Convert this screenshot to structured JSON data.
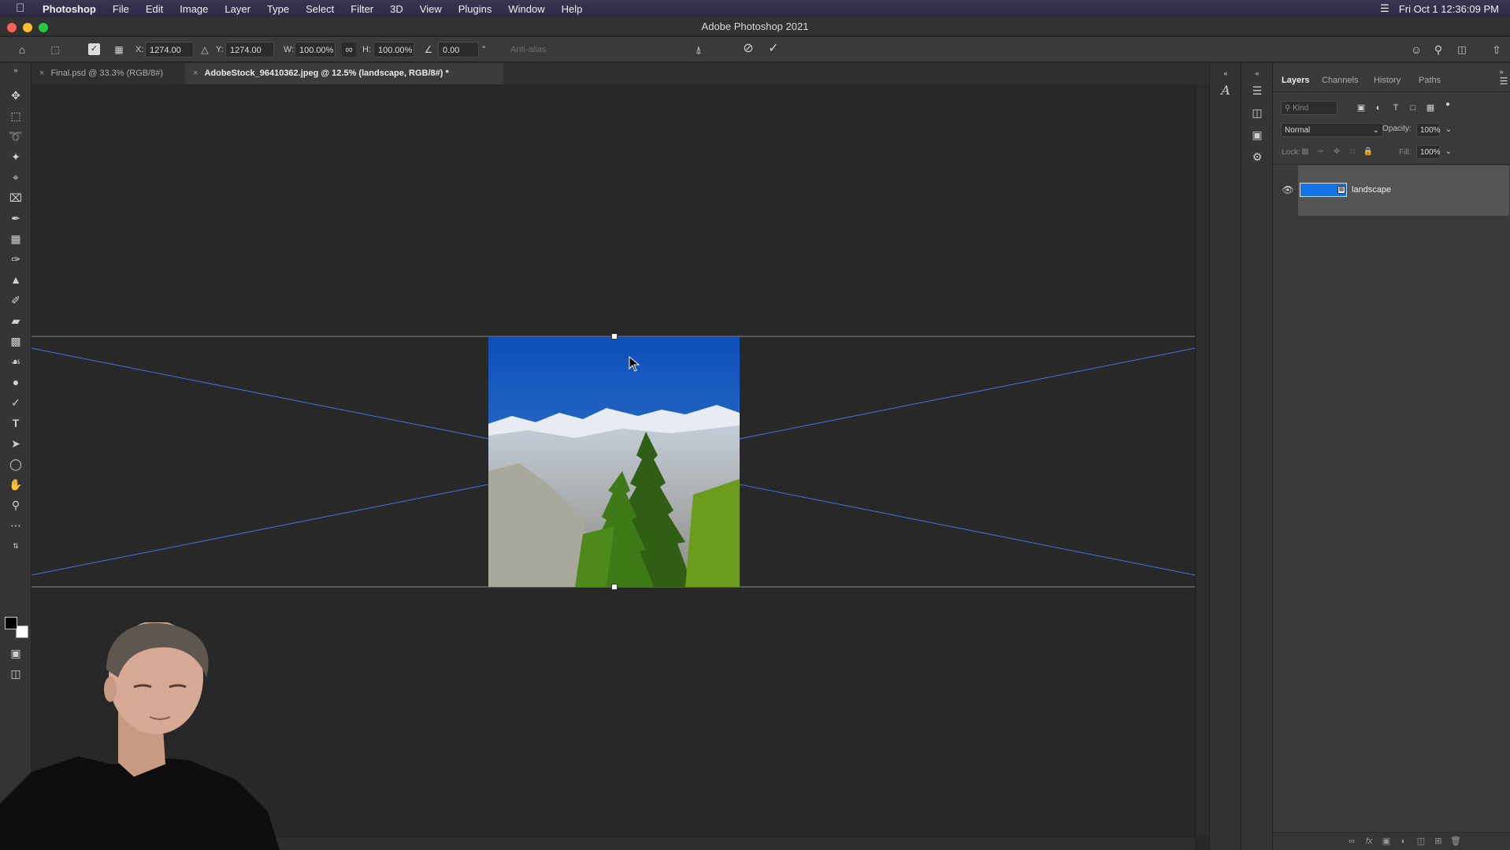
{
  "menubar": {
    "app": "Photoshop",
    "items": [
      "File",
      "Edit",
      "Image",
      "Layer",
      "Type",
      "Select",
      "Filter",
      "3D",
      "View",
      "Plugins",
      "Window",
      "Help"
    ],
    "clock": "Fri Oct 1  12:36:09 PM"
  },
  "window": {
    "title": "Adobe Photoshop 2021"
  },
  "options": {
    "x_label": "X:",
    "x_value": "1274.00 px",
    "y_label": "Y:",
    "y_value": "1274.00 px",
    "w_label": "W:",
    "w_value": "100.00%",
    "h_label": "H:",
    "h_value": "100.00%",
    "angle_value": "0.00",
    "angle_unit": "°",
    "antialias": "Anti-alias"
  },
  "tabs": [
    {
      "label": "Final.psd @ 33.3% (RGB/8#)"
    },
    {
      "label": "AdobeStock_96410362.jpeg @ 12.5% (landscape, RGB/8#) *"
    }
  ],
  "panel": {
    "tabs": [
      "Layers",
      "Channels",
      "History",
      "Paths"
    ],
    "kind_placeholder": "Kind",
    "blend_mode": "Normal",
    "opacity_label": "Opacity:",
    "opacity_value": "100%",
    "lock_label": "Lock:",
    "fill_label": "Fill:",
    "fill_value": "100%",
    "layers": [
      {
        "name": "landscape",
        "visible": true
      }
    ]
  },
  "colors": {
    "accent": "#1473e6",
    "guide": "#4a6ee0"
  }
}
